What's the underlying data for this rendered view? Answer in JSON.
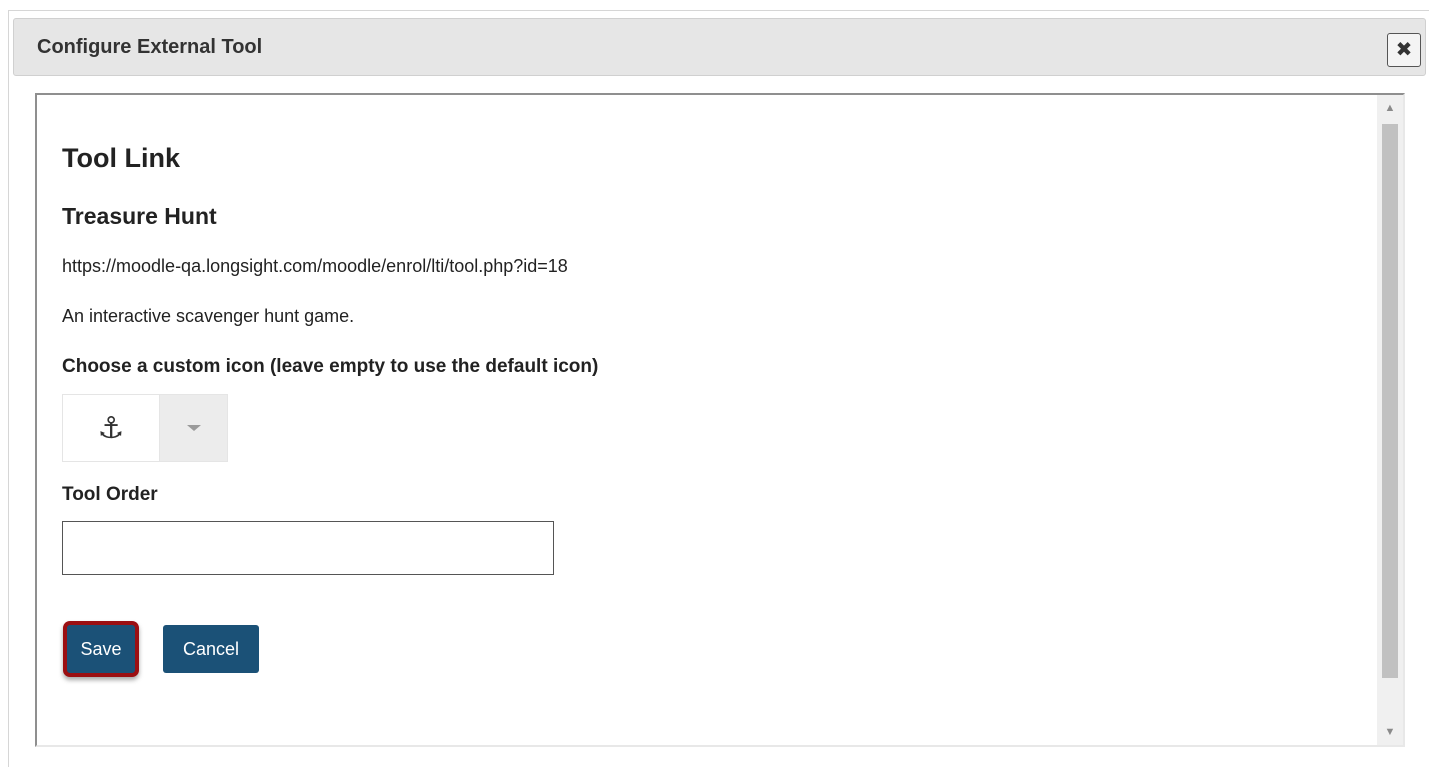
{
  "dialog": {
    "title": "Configure External Tool",
    "close_symbol": "✖"
  },
  "form": {
    "heading": "Tool Link",
    "tool_name": "Treasure Hunt",
    "tool_url": "https://moodle-qa.longsight.com/moodle/enrol/lti/tool.php?id=18",
    "tool_description": "An interactive scavenger hunt game.",
    "icon_label": "Choose a custom icon (leave empty to use the default icon)",
    "icon_glyph": "⚓",
    "icon_name": "anchor-icon",
    "order_label": "Tool Order",
    "order_value": "",
    "order_placeholder": ""
  },
  "buttons": {
    "save_label": "Save",
    "cancel_label": "Cancel"
  },
  "colors": {
    "button_bg": "#1b5177",
    "highlight_outline": "#9b0f12",
    "titlebar_bg": "#e6e6e6"
  }
}
